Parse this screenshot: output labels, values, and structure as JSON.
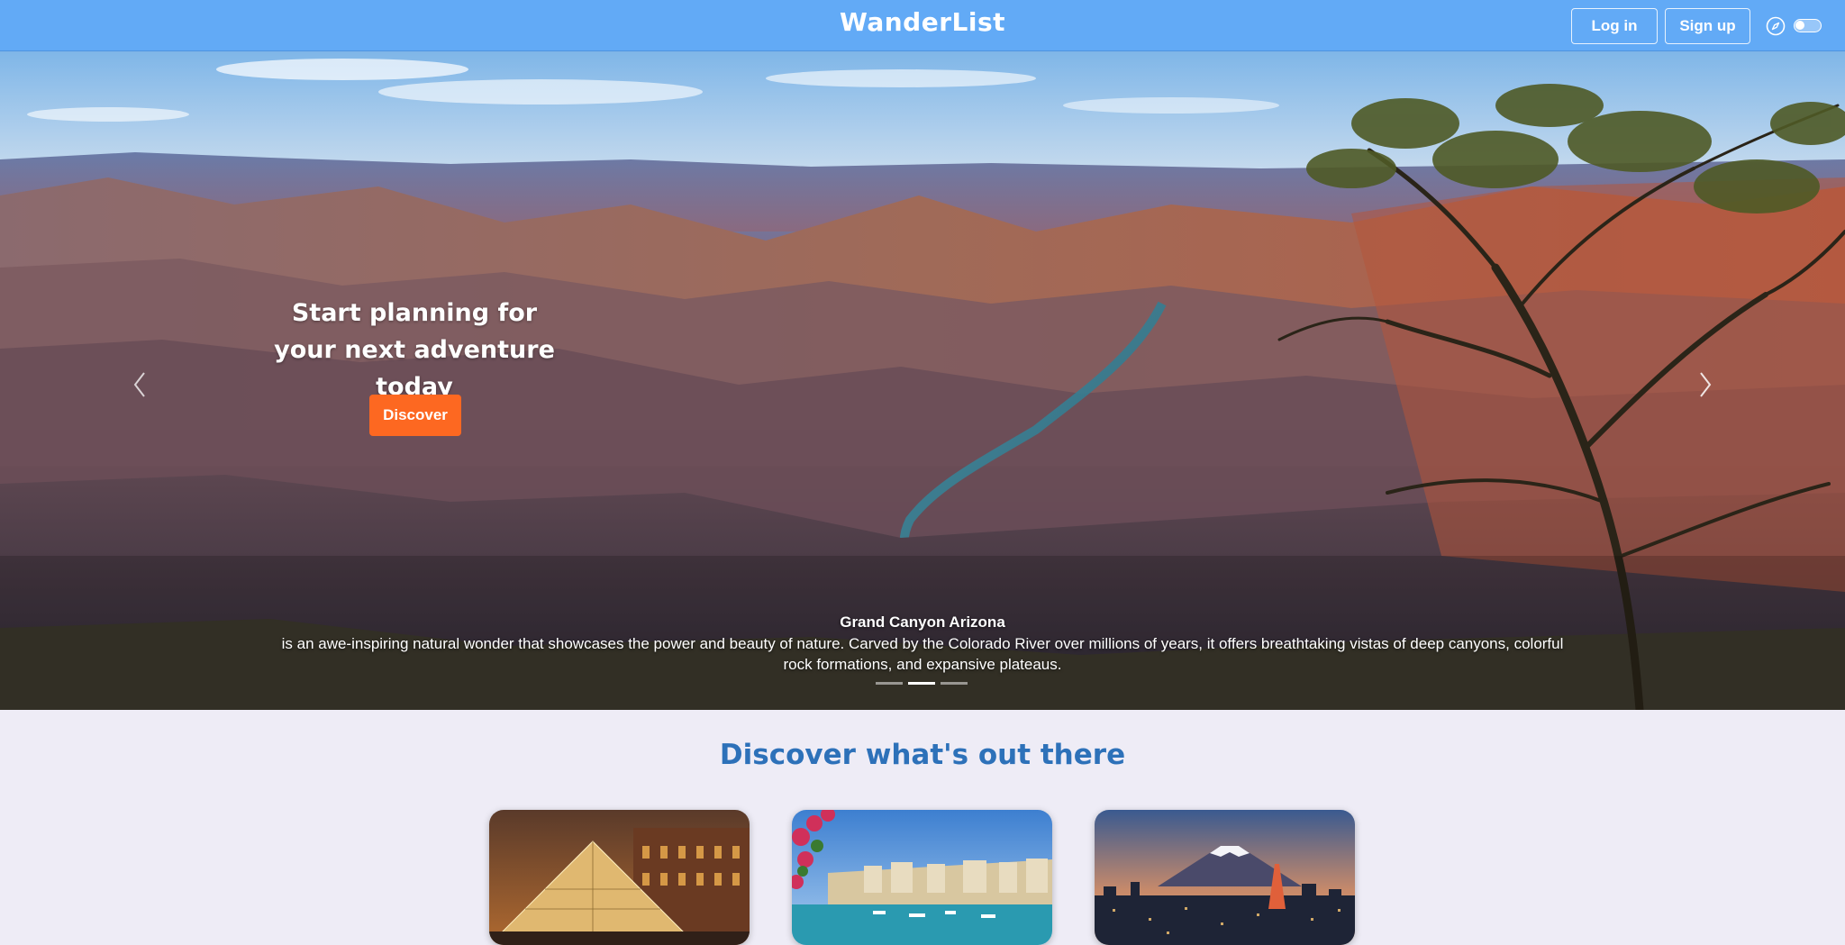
{
  "navbar": {
    "brand": "WanderList",
    "login_label": "Log in",
    "signup_label": "Sign up",
    "compass_icon": "compass-icon",
    "theme_toggle_icon": "toggle-switch-icon",
    "background_color": "#62aaf6"
  },
  "hero": {
    "headline": "Start planning for your next adventure today",
    "discover_label": "Discover",
    "discover_color": "#fd6821",
    "caption_title": "Grand Canyon Arizona",
    "caption_text": "is an awe-inspiring natural wonder that showcases the power and beauty of nature. Carved by the Colorado River over millions of years, it offers breathtaking vistas of deep canyons, colorful rock formations, and expansive plateaus.",
    "slide_count": 3,
    "active_slide": 2,
    "prev_icon": "chevron-left-icon",
    "next_icon": "chevron-right-icon"
  },
  "discover_section": {
    "title": "Discover what's out there",
    "title_color": "#2d71b9",
    "cards": [
      {
        "image": "louvre-pyramid-night-photo"
      },
      {
        "image": "coastal-harbor-town-photo"
      },
      {
        "image": "mount-fuji-city-skyline-photo"
      }
    ]
  }
}
